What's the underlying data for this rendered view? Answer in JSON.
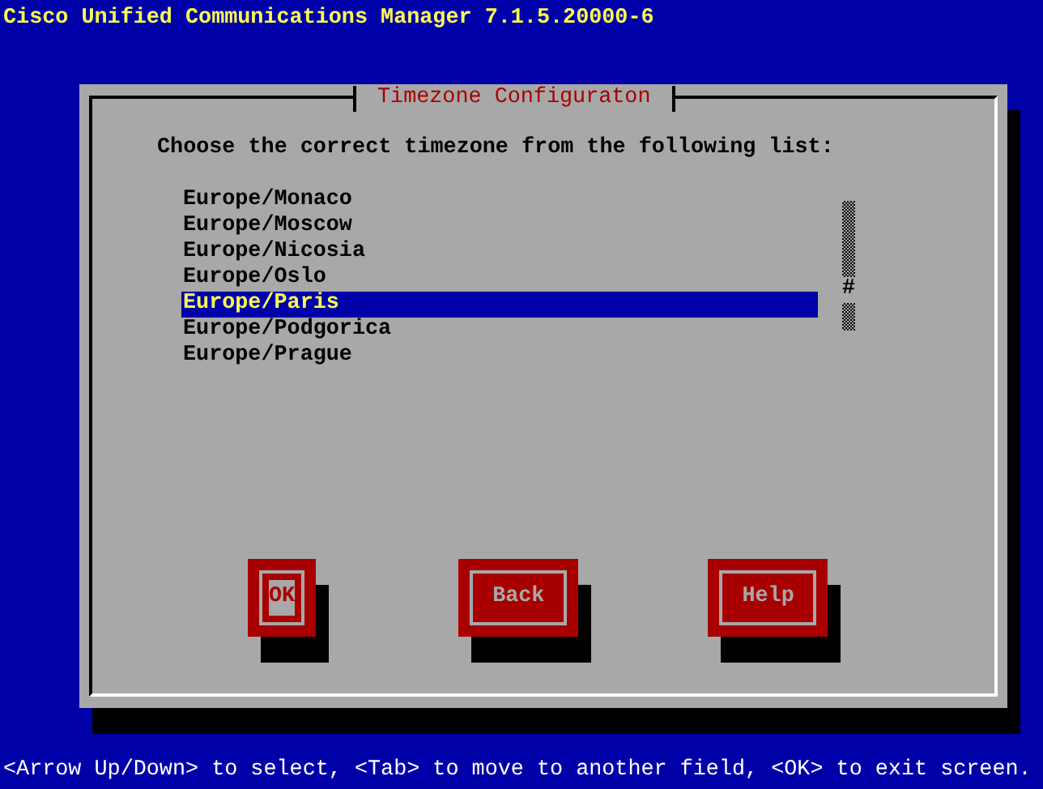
{
  "header": {
    "title": "Cisco Unified Communications Manager 7.1.5.20000-6"
  },
  "dialog": {
    "title": "Timezone Configuraton",
    "prompt": "Choose the correct timezone from the following list:",
    "items": [
      {
        "label": "Europe/Monaco",
        "selected": false
      },
      {
        "label": "Europe/Moscow",
        "selected": false
      },
      {
        "label": "Europe/Nicosia",
        "selected": false
      },
      {
        "label": "Europe/Oslo",
        "selected": false
      },
      {
        "label": "Europe/Paris",
        "selected": true
      },
      {
        "label": "Europe/Podgorica",
        "selected": false
      },
      {
        "label": "Europe/Prague",
        "selected": false
      }
    ],
    "scroll_thumb": "#",
    "buttons": [
      {
        "label": "OK",
        "focused": true
      },
      {
        "label": "Back",
        "focused": false
      },
      {
        "label": "Help",
        "focused": false
      }
    ]
  },
  "status_bar": "<Arrow Up/Down> to select, <Tab> to move to another field, <OK> to exit screen."
}
